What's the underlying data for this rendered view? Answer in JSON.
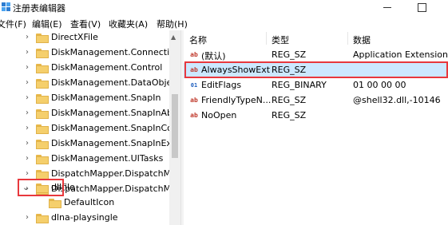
{
  "window": {
    "title": "注册表编辑器",
    "icon": "registry-editor-icon"
  },
  "menu": [
    "文件(F)",
    "编辑(E)",
    "查看(V)",
    "收藏夹(A)",
    "帮助(H)"
  ],
  "tree": {
    "items": [
      {
        "label": "DirectXFile",
        "expanded": false
      },
      {
        "label": "DiskManagement.Connection",
        "expanded": false
      },
      {
        "label": "DiskManagement.Control",
        "expanded": false
      },
      {
        "label": "DiskManagement.DataObject",
        "expanded": false
      },
      {
        "label": "DiskManagement.SnapIn",
        "expanded": false
      },
      {
        "label": "DiskManagement.SnapInAbou",
        "expanded": false
      },
      {
        "label": "DiskManagement.SnapInComp",
        "expanded": false
      },
      {
        "label": "DiskManagement.SnapInExten",
        "expanded": false
      },
      {
        "label": "DiskManagement.UITasks",
        "expanded": false
      },
      {
        "label": "DispatchMapper.DispatchMap",
        "expanded": false
      },
      {
        "label": "DispatchMapper.DispatchMap",
        "expanded": false
      },
      {
        "label": "dllfile",
        "expanded": true,
        "highlighted": true
      },
      {
        "label": "DefaultIcon",
        "child": true
      },
      {
        "label": "dlna-playsingle",
        "expanded": false
      }
    ]
  },
  "list": {
    "columns": [
      "名称",
      "类型",
      "数据"
    ],
    "rows": [
      {
        "name": "(默认)",
        "type": "REG_SZ",
        "data": "Application Extension",
        "icon": "ab"
      },
      {
        "name": "AlwaysShowExt",
        "type": "REG_SZ",
        "data": "",
        "icon": "ab",
        "selected": true,
        "highlighted": true
      },
      {
        "name": "EditFlags",
        "type": "REG_BINARY",
        "data": "01 00 00 00",
        "icon": "bin"
      },
      {
        "name": "FriendlyTypeN...",
        "type": "REG_SZ",
        "data": "@shell32.dll,-10146",
        "icon": "ab"
      },
      {
        "name": "NoOpen",
        "type": "REG_SZ",
        "data": "",
        "icon": "ab"
      }
    ]
  },
  "colors": {
    "highlight_border": "#e8383d",
    "selection": "#cce8ff",
    "folder": "#f5cf6c"
  }
}
